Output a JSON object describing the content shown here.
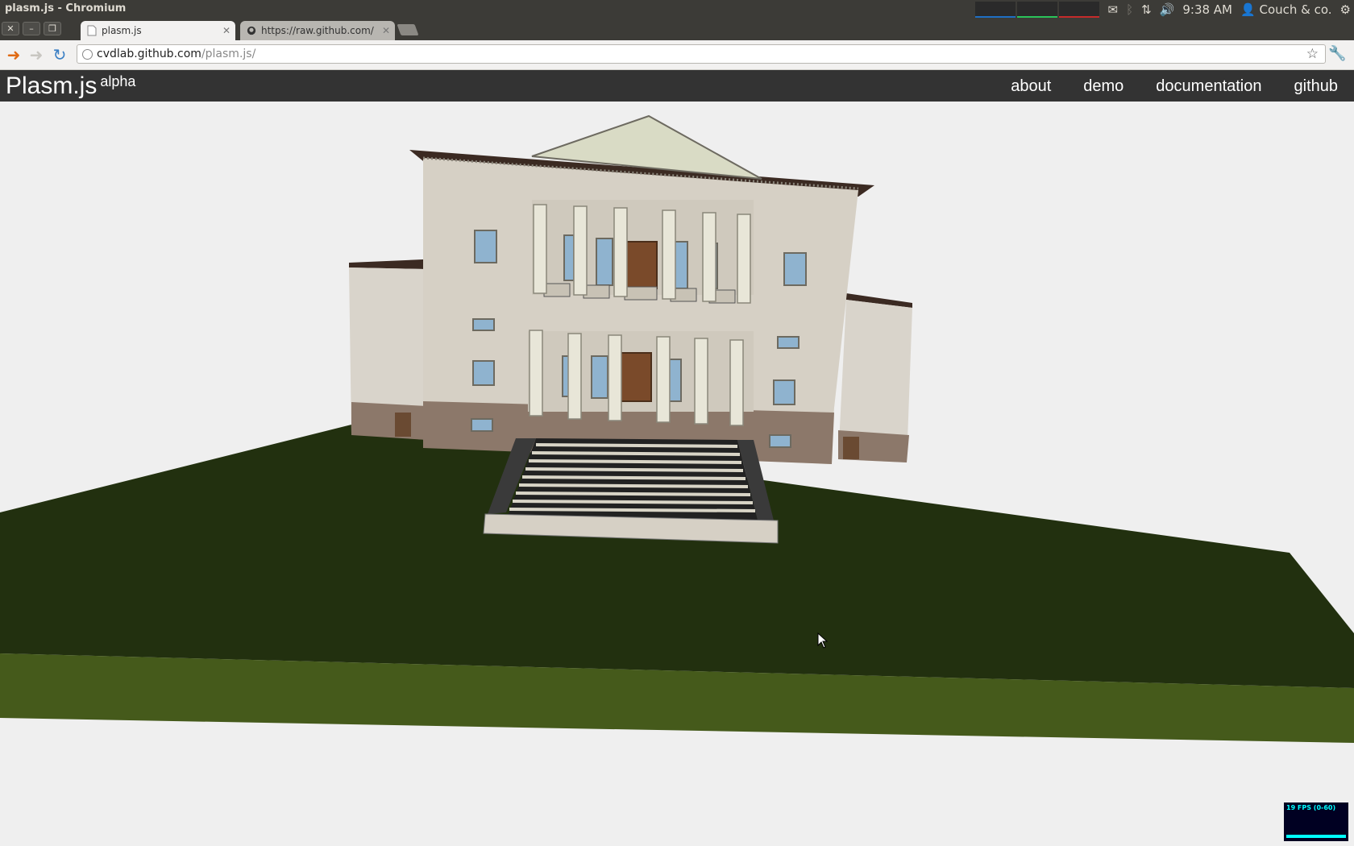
{
  "window": {
    "title": "plasm.js - Chromium"
  },
  "os_panel": {
    "time": "9:38 AM",
    "user": "Couch & co.",
    "icons": [
      "system-monitor",
      "mail-icon",
      "bluetooth-icon",
      "network-icon",
      "volume-icon",
      "user-icon",
      "power-gear-icon"
    ]
  },
  "tabs": [
    {
      "label": "plasm.js",
      "active": true
    },
    {
      "label": "https://raw.github.com/cv",
      "active": false
    }
  ],
  "address_bar": {
    "host": "cvdlab.github.com",
    "path": "/plasm.js/"
  },
  "site": {
    "brand": "Plasm.js",
    "brand_sup": "alpha",
    "nav": [
      "about",
      "demo",
      "documentation",
      "github"
    ]
  },
  "fps_meter": {
    "label": "19 FPS (0-60)",
    "fps": 19,
    "range": [
      0,
      60
    ]
  },
  "colors": {
    "page_bg": "#efefef",
    "header_bg": "#333333",
    "ground_dark": "#22300f",
    "ground_light": "#455a1b",
    "facade": "#d6d0c5",
    "base": "#8c786a",
    "roof": "#3b2a22"
  }
}
